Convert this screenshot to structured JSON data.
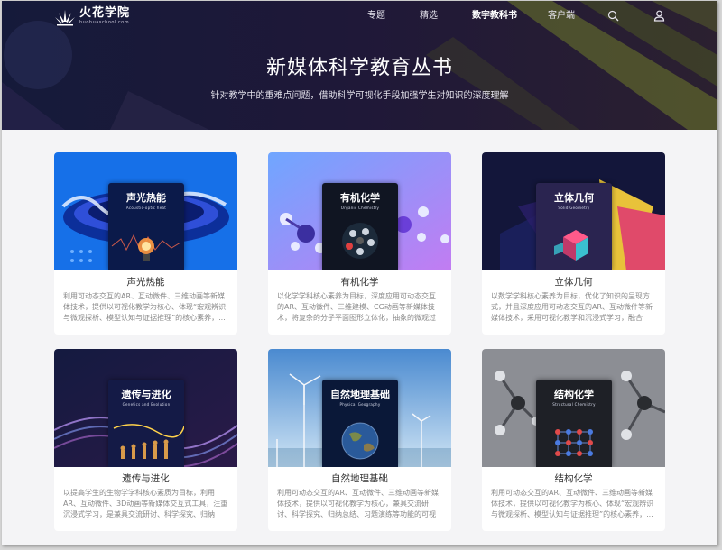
{
  "brand": {
    "name": "火花学院",
    "domain": "huohuaschool.com"
  },
  "nav": {
    "items": [
      {
        "label": "专题"
      },
      {
        "label": "精选"
      },
      {
        "label": "数字教科书",
        "active": true
      },
      {
        "label": "客户端"
      }
    ],
    "icons": [
      "search-icon",
      "user-icon"
    ]
  },
  "hero": {
    "title": "新媒体科学教育丛书",
    "subtitle": "针对教学中的重难点问题，借助科学可视化手段加强学生对知识的深度理解"
  },
  "books": [
    {
      "title": "声光热能",
      "cover_title": "声光热能",
      "cover_subtitle": "Acoustic-optic heat",
      "description": "利用可动态交互的AR、互动微件、三维动画等新媒体技术，提供以可视化教学为核心、体现“宏观辨识与微观探析、模型认知与证据推理”的核心素养，..."
    },
    {
      "title": "有机化学",
      "cover_title": "有机化学",
      "cover_subtitle": "Organic Chemistry",
      "description": "以化学学科核心素养为目标，深度应用可动态交互的AR、互动微件、三维建模、CG动画等新媒体技术，将复杂的分子平面图形立体化，抽象的微观过程可..."
    },
    {
      "title": "立体几何",
      "cover_title": "立体几何",
      "cover_subtitle": "Solid Geometry",
      "description": "以数学学科核心素养为目标，优化了知识的呈现方式，并且深度应用可动态交互的AR、互动微件等新媒体技术，采用可视化教学和沉浸式学习，融合科..."
    },
    {
      "title": "遗传与进化",
      "cover_title": "遗传与进化",
      "cover_subtitle": "Genetics and Evolution",
      "description": "以提高学生的生物学学科核心素质为目标，利用AR、互动微件、3D动画等新媒体交互式工具，注重沉浸式学习，是兼具交流研讨、科学探究、归纳总..."
    },
    {
      "title": "自然地理基础",
      "cover_title": "自然地理基础",
      "cover_subtitle": "Physical Geography",
      "description": "利用可动态交互的AR、互动微件、三维动画等新媒体技术，提供以可视化教学为核心，兼具交流研讨、科学探究、归纳总结、习题演练等功能的可视化教..."
    },
    {
      "title": "结构化学",
      "cover_title": "结构化学",
      "cover_subtitle": "Structural Chemistry",
      "description": "利用可动态交互的AR、互动微件、三维动画等新媒体技术，提供以可视化教学为核心、体现“宏观辨识与微观探析、模型认知与证据推理”的核心素养，..."
    }
  ]
}
